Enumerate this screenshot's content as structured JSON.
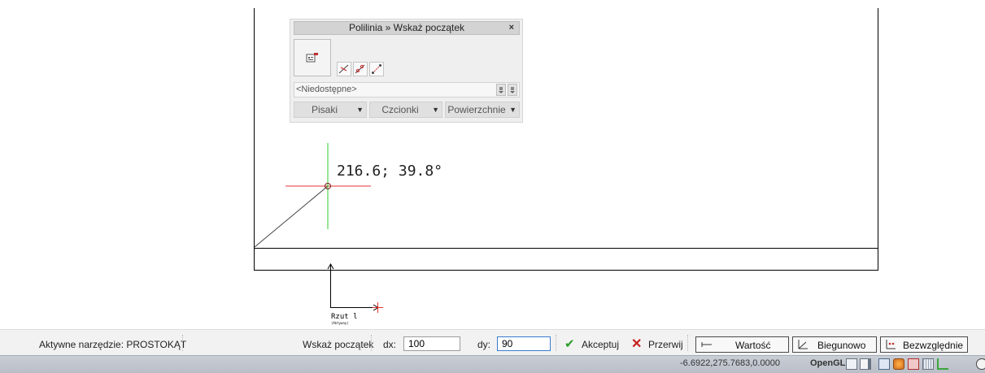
{
  "palette": {
    "title": "Polilinia » Wskaż początek",
    "close_glyph": "×",
    "select_value": "<Niedostępne>",
    "dropdowns": [
      {
        "label": "Pisaki"
      },
      {
        "label": "Czcionki"
      },
      {
        "label": "Powierzchnie"
      }
    ]
  },
  "canvas": {
    "cursor_readout": "216.6; 39.8°",
    "view_label": "Rzut l",
    "view_sublabel": "(Aktywny)"
  },
  "statusbar": {
    "active_tool": "Aktywne narzędzie: PROSTOKĄT",
    "prompt": "Wskaż początek",
    "dx_label": "dx:",
    "dx_value": "100",
    "dy_label": "dy:",
    "dy_value": "90",
    "accept_label": "Akceptuj",
    "cancel_label": "Przerwij",
    "mode_value": "Wartość",
    "mode_polar": "Biegunowo",
    "mode_absolute": "Bezwzględnie"
  },
  "bottombar": {
    "coordinates": "-6.6922,275.7683,0.0000",
    "renderer": "OpenGL"
  },
  "colors": {
    "accent_green": "#2a9d2a",
    "cancel_red": "#c8201e",
    "crosshair_red": "#e53030",
    "crosshair_green": "#2ecc2e"
  }
}
